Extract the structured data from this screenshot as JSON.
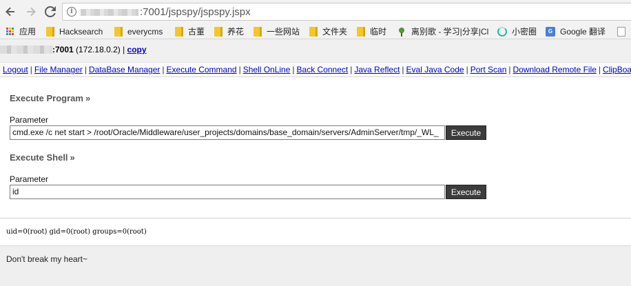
{
  "browser": {
    "url_suffix": ":7001/jspspy/jspspy.jspx",
    "bookmarks": [
      {
        "label": "应用",
        "icon": "apps-grid-icon"
      },
      {
        "label": "Hacksearch",
        "icon": "folder-icon"
      },
      {
        "label": "everycms",
        "icon": "folder-icon"
      },
      {
        "label": "古董",
        "icon": "folder-icon"
      },
      {
        "label": "养花",
        "icon": "folder-icon"
      },
      {
        "label": "一些网站",
        "icon": "folder-icon"
      },
      {
        "label": "文件夹",
        "icon": "folder-icon"
      },
      {
        "label": "临时",
        "icon": "folder-icon"
      },
      {
        "label": "离别歌 - 学习|分享|Cl",
        "icon": "tree-favicon-icon"
      },
      {
        "label": "小密圈",
        "icon": "ring-favicon-icon"
      },
      {
        "label": "Google 翻译",
        "icon": "google-translate-icon"
      }
    ]
  },
  "host": {
    "port": ":7001",
    "ip": " (172.18.0.2) | ",
    "copy_label": "copy"
  },
  "menu": [
    "Logout",
    "File Manager",
    "DataBase Manager",
    "Execute Command",
    "Shell OnLine",
    "Back Connect",
    "Java Reflect",
    "Eval Java Code",
    "Port Scan",
    "Download Remote File",
    "ClipBoard"
  ],
  "execute_program": {
    "title": "Execute Program",
    "raquo": "»",
    "param_label": "Parameter",
    "value": "cmd.exe /c net start > /root/Oracle/Middleware/user_projects/domains/base_domain/servers/AdminServer/tmp/_WL_",
    "button": "Execute"
  },
  "execute_shell": {
    "title": "Execute Shell",
    "raquo": "»",
    "param_label": "Parameter",
    "value": "id",
    "button": "Execute"
  },
  "output": "uid=0(root) gid=0(root) groups=0(root)",
  "footer": "Don't break my heart~"
}
